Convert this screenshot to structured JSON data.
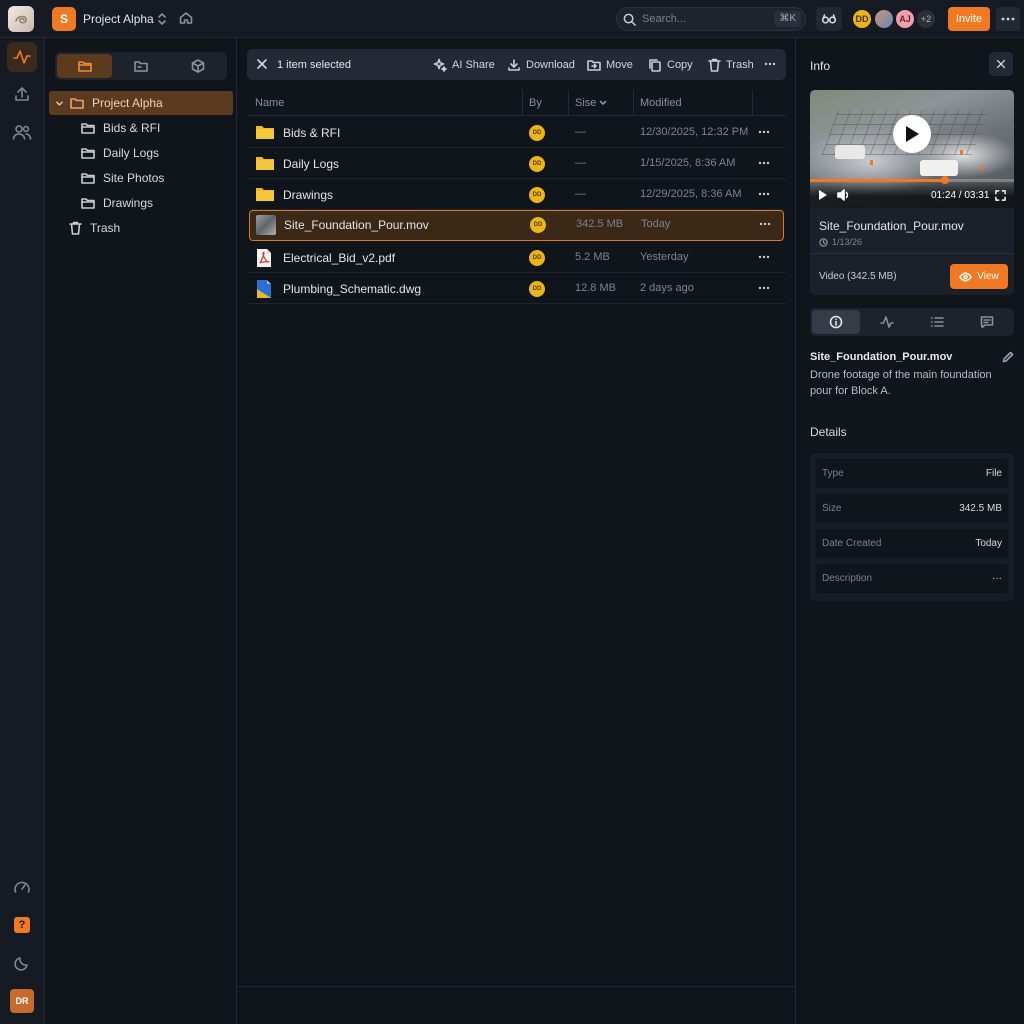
{
  "project": {
    "badge": "S",
    "name": "Project Alpha"
  },
  "search": {
    "placeholder": "Search...",
    "shortcut": "⌘K"
  },
  "collaborators": [
    {
      "initials": "DD",
      "color": "#e9b51d"
    },
    {
      "initials": "",
      "color": "#c99677"
    },
    {
      "initials": "AJ",
      "color": "#f0a0ab"
    }
  ],
  "collaborators_extra": "+2",
  "invite_label": "Invite",
  "user_initials": "DR",
  "tree": {
    "root": "Project Alpha",
    "children": [
      "Bids & RFI",
      "Daily Logs",
      "Site Photos",
      "Drawings"
    ],
    "trash": "Trash"
  },
  "action_bar": {
    "selection": "1 item selected",
    "ai_share": "AI Share",
    "download": "Download",
    "move": "Move",
    "copy": "Copy",
    "trash": "Trash"
  },
  "columns": {
    "name": "Name",
    "by": "By",
    "size": "Sise",
    "modified": "Modified"
  },
  "files": [
    {
      "name": "Bids & RFI",
      "kind": "folder",
      "by": "DD",
      "size": "—",
      "modified": "12/30/2025, 12:32 PM",
      "selected": false
    },
    {
      "name": "Daily Logs",
      "kind": "folder",
      "by": "DD",
      "size": "—",
      "modified": "1/15/2025, 8:36 AM",
      "selected": false
    },
    {
      "name": "Drawings",
      "kind": "folder",
      "by": "DD",
      "size": "—",
      "modified": "12/29/2025, 8:36 AM",
      "selected": false
    },
    {
      "name": "Site_Foundation_Pour.mov",
      "kind": "video",
      "by": "DD",
      "size": "342.5 MB",
      "modified": "Today",
      "selected": true
    },
    {
      "name": "Electrical_Bid_v2.pdf",
      "kind": "pdf",
      "by": "DD",
      "size": "5.2 MB",
      "modified": "Yesterday",
      "selected": false
    },
    {
      "name": "Plumbing_Schematic.dwg",
      "kind": "dwg",
      "by": "DD",
      "size": "12.8 MB",
      "modified": "2 days ago",
      "selected": false
    }
  ],
  "info": {
    "title": "Info",
    "preview": {
      "file_name": "Site_Foundation_Pour.mov",
      "date": "1/13/26",
      "time": "01:24 / 03:31",
      "progress": 0.66,
      "type_label": "Video (342.5 MB)",
      "view_label": "View"
    },
    "description_name": "Site_Foundation_Pour.mov",
    "description": "Drone footage of the main foundation pour for Block A.",
    "details_title": "Details",
    "details": [
      {
        "key": "Type",
        "value": "File"
      },
      {
        "key": "Size",
        "value": "342.5 MB"
      },
      {
        "key": "Date Created",
        "value": "Today"
      },
      {
        "key": "Description",
        "value": "···"
      }
    ]
  },
  "colors": {
    "accent": "#f07a23",
    "background": "#0f1218",
    "selected_row": "#3b2816"
  }
}
